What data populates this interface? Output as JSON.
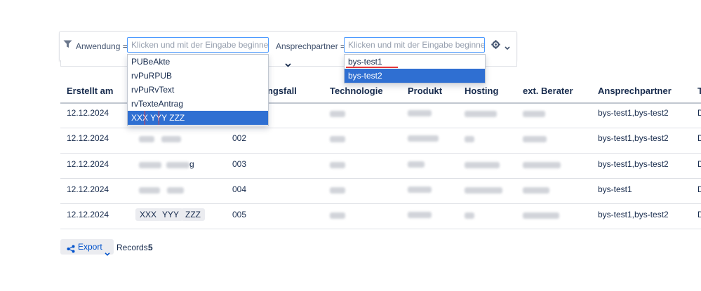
{
  "filters": {
    "anwendung_label": "Anwendung =",
    "ansprechpartner_label": "Ansprechpartner =",
    "anwendung_placeholder": "Klicken und mit der Eingabe beginnen...",
    "ansprechpartner_placeholder": "Klicken und mit der Eingabe beginnen..."
  },
  "anwendung_dropdown": {
    "options": [
      "PUBeAkte",
      "rvPuRPUB",
      "rvPuRvText",
      "rvTexteAntrag",
      "XXX YYY ZZZ"
    ],
    "selected": "XXX YYY ZZZ"
  },
  "ansprechpartner_dropdown": {
    "input_value": "bys-test1",
    "options": [
      "bys-test2"
    ]
  },
  "table": {
    "headers": {
      "erstellt": "Erstellt am",
      "fall": "ungsfall",
      "technologie": "Technologie",
      "produkt": "Produkt",
      "hosting": "Hosting",
      "berater": "ext. Berater",
      "ansprechpartner": "Ansprechpartner",
      "last": "T"
    },
    "rows": [
      {
        "date": "12.12.2024",
        "num": "",
        "ansprechpartner": "bys-test1,bys-test2",
        "last": "D"
      },
      {
        "date": "12.12.2024",
        "num": "002",
        "ansprechpartner": "bys-test1,bys-test2",
        "last": "D"
      },
      {
        "date": "12.12.2024",
        "num": "003",
        "ansprechpartner": "bys-test1,bys-test2",
        "last": "D"
      },
      {
        "date": "12.12.2024",
        "num": "004",
        "ansprechpartner": "bys-test1",
        "last": "D"
      },
      {
        "date": "12.12.2024",
        "num": "005",
        "ansprechpartner": "bys-test1,bys-test2",
        "last": "D"
      }
    ],
    "row5_chips": [
      "XXX",
      "YYY",
      "ZZZ"
    ],
    "row3_partial": "g"
  },
  "footer": {
    "export_label": "Export",
    "records_label": "Records:",
    "records_count": "5"
  },
  "icons": {
    "filter": "filter-icon",
    "settings": "gear-icon",
    "chevron": "chevron-down-icon",
    "export": "share-icon"
  },
  "colors": {
    "selected": "#2f6fd2",
    "focus_border": "#4c9aff",
    "link": "#0052cc"
  }
}
